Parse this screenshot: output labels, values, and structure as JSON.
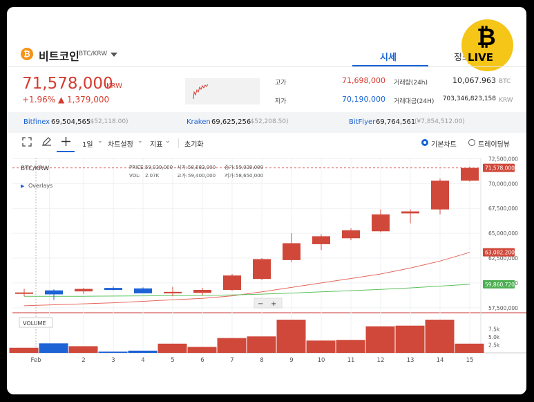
{
  "header": {
    "coin_name": "비트코인",
    "pair": "BTC/KRW",
    "tab_active": "시세",
    "tab_other": "정보",
    "logo_text": "LIVE"
  },
  "summary": {
    "price": "71,578,000",
    "currency": "KRW",
    "change": "+1.96% ▲ 1,379,000",
    "high_label": "고가",
    "high_value": "71,698,000",
    "low_label": "저가",
    "low_value": "70,190,000",
    "vol_label": "거래량(24h)",
    "vol_value": "10,067.963",
    "vol_unit": "BTC",
    "amt_label": "거래대금(24H)",
    "amt_value": "703,346,823,158",
    "amt_unit": "KRW"
  },
  "exchanges": [
    {
      "name": "Bitfinex",
      "value": "69,504,565",
      "sub": "($52,118.00)"
    },
    {
      "name": "Kraken",
      "value": "69,625,256",
      "sub": "($52,208.50)"
    },
    {
      "name": "BitFlyer",
      "value": "69,764,561",
      "sub": "(¥7,854,512.00)"
    }
  ],
  "toolbar": {
    "interval": "1일",
    "settings": "차트설정",
    "indicator": "지표",
    "reset": "초기화",
    "basic_chart": "기본차트",
    "tradingview": "트레이딩뷰"
  },
  "colors": {
    "up": "#d0483a",
    "down": "#1e63d6",
    "ma_red": "#e4675c",
    "ma_green": "#5cc15c",
    "accent": "#1763d5"
  },
  "chart_data": {
    "type": "candlestick",
    "symbol": "BTC/KRW",
    "overlays_label": "Overlays",
    "ohlc_legend": {
      "price_label": "PRICE:",
      "price": "59,039,000",
      "vol_label": "VOL:",
      "vol": "2.07K",
      "open_label": "시가:",
      "open": "58,882,000",
      "high_label": "고가:",
      "high": "59,400,000",
      "close_label": "종가:",
      "close": "59,039,000",
      "low_label": "저가:",
      "low": "58,650,000"
    },
    "x_labels": [
      "Feb",
      "2",
      "3",
      "4",
      "5",
      "6",
      "7",
      "8",
      "9",
      "10",
      "11",
      "12",
      "13",
      "14",
      "15"
    ],
    "candles": [
      {
        "o": 59000000,
        "h": 59400000,
        "l": 58650000,
        "c": 59039000,
        "v": 1600
      },
      {
        "o": 59250000,
        "h": 59350000,
        "l": 58300000,
        "c": 58850000,
        "v": 3000
      },
      {
        "o": 59150000,
        "h": 59500000,
        "l": 58900000,
        "c": 59400000,
        "v": 2100
      },
      {
        "o": 59500000,
        "h": 59650000,
        "l": 59250000,
        "c": 59300000,
        "v": 400
      },
      {
        "o": 59450000,
        "h": 59550000,
        "l": 58950000,
        "c": 58950000,
        "v": 700
      },
      {
        "o": 58950000,
        "h": 59600000,
        "l": 58650000,
        "c": 59100000,
        "v": 2900
      },
      {
        "o": 59000000,
        "h": 59500000,
        "l": 58750000,
        "c": 59300000,
        "v": 1900
      },
      {
        "o": 59300000,
        "h": 60900000,
        "l": 59200000,
        "c": 60750000,
        "v": 4700
      },
      {
        "o": 60400000,
        "h": 62500000,
        "l": 60300000,
        "c": 62400000,
        "v": 5200
      },
      {
        "o": 62300000,
        "h": 65000000,
        "l": 62100000,
        "c": 64000000,
        "v": 10500
      },
      {
        "o": 63900000,
        "h": 64900000,
        "l": 63300000,
        "c": 64700000,
        "v": 3900
      },
      {
        "o": 64500000,
        "h": 65500000,
        "l": 64300000,
        "c": 65300000,
        "v": 4100
      },
      {
        "o": 65200000,
        "h": 67400000,
        "l": 65100000,
        "c": 66900000,
        "v": 8400
      },
      {
        "o": 67000000,
        "h": 67400000,
        "l": 66000000,
        "c": 67200000,
        "v": 8600
      },
      {
        "o": 67400000,
        "h": 70500000,
        "l": 66900000,
        "c": 70300000,
        "v": 10500
      },
      {
        "o": 70300000,
        "h": 71700000,
        "l": 70190000,
        "c": 71578000,
        "v": 2900
      }
    ],
    "ma_slow": [
      57700000,
      57800000,
      57900000,
      58000000,
      58150000,
      58300000,
      58450000,
      58700000,
      59100000,
      59550000,
      60000000,
      60450000,
      60900000,
      61500000,
      62200000,
      63082200
    ],
    "ma_fast": [
      58650000,
      58650000,
      58660000,
      58680000,
      58700000,
      58720000,
      58750000,
      58800000,
      58870000,
      58980000,
      59100000,
      59220000,
      59350000,
      59500000,
      59680000,
      59860720
    ],
    "y_ticks": [
      "72,500,000",
      "70,000,000",
      "67,500,000",
      "65,000,000",
      "62,500,000",
      "60,000,000",
      "57,500,000"
    ],
    "y_tick_values": [
      72500000,
      70000000,
      67500000,
      65000000,
      62500000,
      60000000,
      57500000
    ],
    "price_tags": [
      {
        "label": "71,578,000",
        "value": 71578000,
        "color": "#d0483a"
      },
      {
        "label": "63,082,200",
        "value": 63082200,
        "color": "#d0483a"
      },
      {
        "label": "59,860,720",
        "value": 59860720,
        "color": "#4caf50"
      }
    ],
    "ylim": [
      57000000,
      72600000
    ],
    "volume_label": "VOLUME",
    "vol_ticks": [
      "7.5k",
      "5.0k",
      "2.5k"
    ],
    "vol_tick_values": [
      7500,
      5000,
      2500
    ],
    "vol_max": 10500,
    "zoom_minus": "−",
    "zoom_plus": "+"
  }
}
